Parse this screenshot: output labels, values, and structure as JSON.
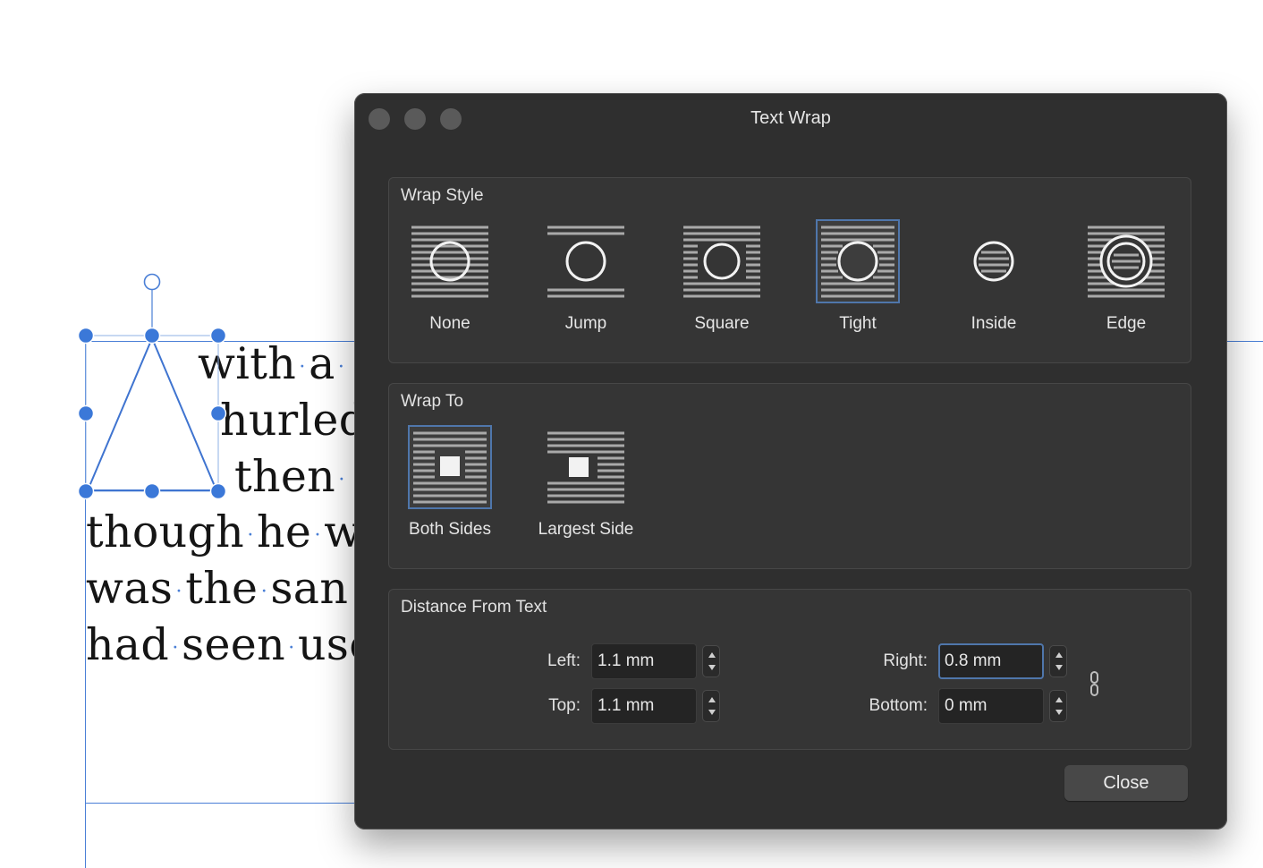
{
  "document": {
    "lines": [
      {
        "words": [
          "with",
          "a"
        ]
      },
      {
        "words": [
          "hurled"
        ]
      },
      {
        "words": [
          "then"
        ]
      },
      {
        "words": [
          "though",
          "he",
          "w"
        ]
      },
      {
        "words": [
          "was",
          "the",
          "san"
        ]
      },
      {
        "words": [
          "had",
          "seen",
          "use"
        ]
      }
    ],
    "selection_color": "#4a7fd6"
  },
  "dialog": {
    "title": "Text Wrap",
    "wrap_style": {
      "heading": "Wrap Style",
      "options": [
        {
          "label": "None",
          "icon": "wrap-none-icon",
          "selected": false
        },
        {
          "label": "Jump",
          "icon": "wrap-jump-icon",
          "selected": false
        },
        {
          "label": "Square",
          "icon": "wrap-square-icon",
          "selected": false
        },
        {
          "label": "Tight",
          "icon": "wrap-tight-icon",
          "selected": true
        },
        {
          "label": "Inside",
          "icon": "wrap-inside-icon",
          "selected": false
        },
        {
          "label": "Edge",
          "icon": "wrap-edge-icon",
          "selected": false
        }
      ]
    },
    "wrap_to": {
      "heading": "Wrap To",
      "options": [
        {
          "label": "Both Sides",
          "icon": "wrap-both-sides-icon",
          "selected": true
        },
        {
          "label": "Largest Side",
          "icon": "wrap-largest-side-icon",
          "selected": false
        }
      ]
    },
    "distance": {
      "heading": "Distance From Text",
      "left_label": "Left:",
      "left_value": "1.1 mm",
      "top_label": "Top:",
      "top_value": "1.1 mm",
      "right_label": "Right:",
      "right_value": "0.8 mm",
      "bottom_label": "Bottom:",
      "bottom_value": "0 mm"
    },
    "close_label": "Close",
    "accent_color": "#4f76ab"
  }
}
